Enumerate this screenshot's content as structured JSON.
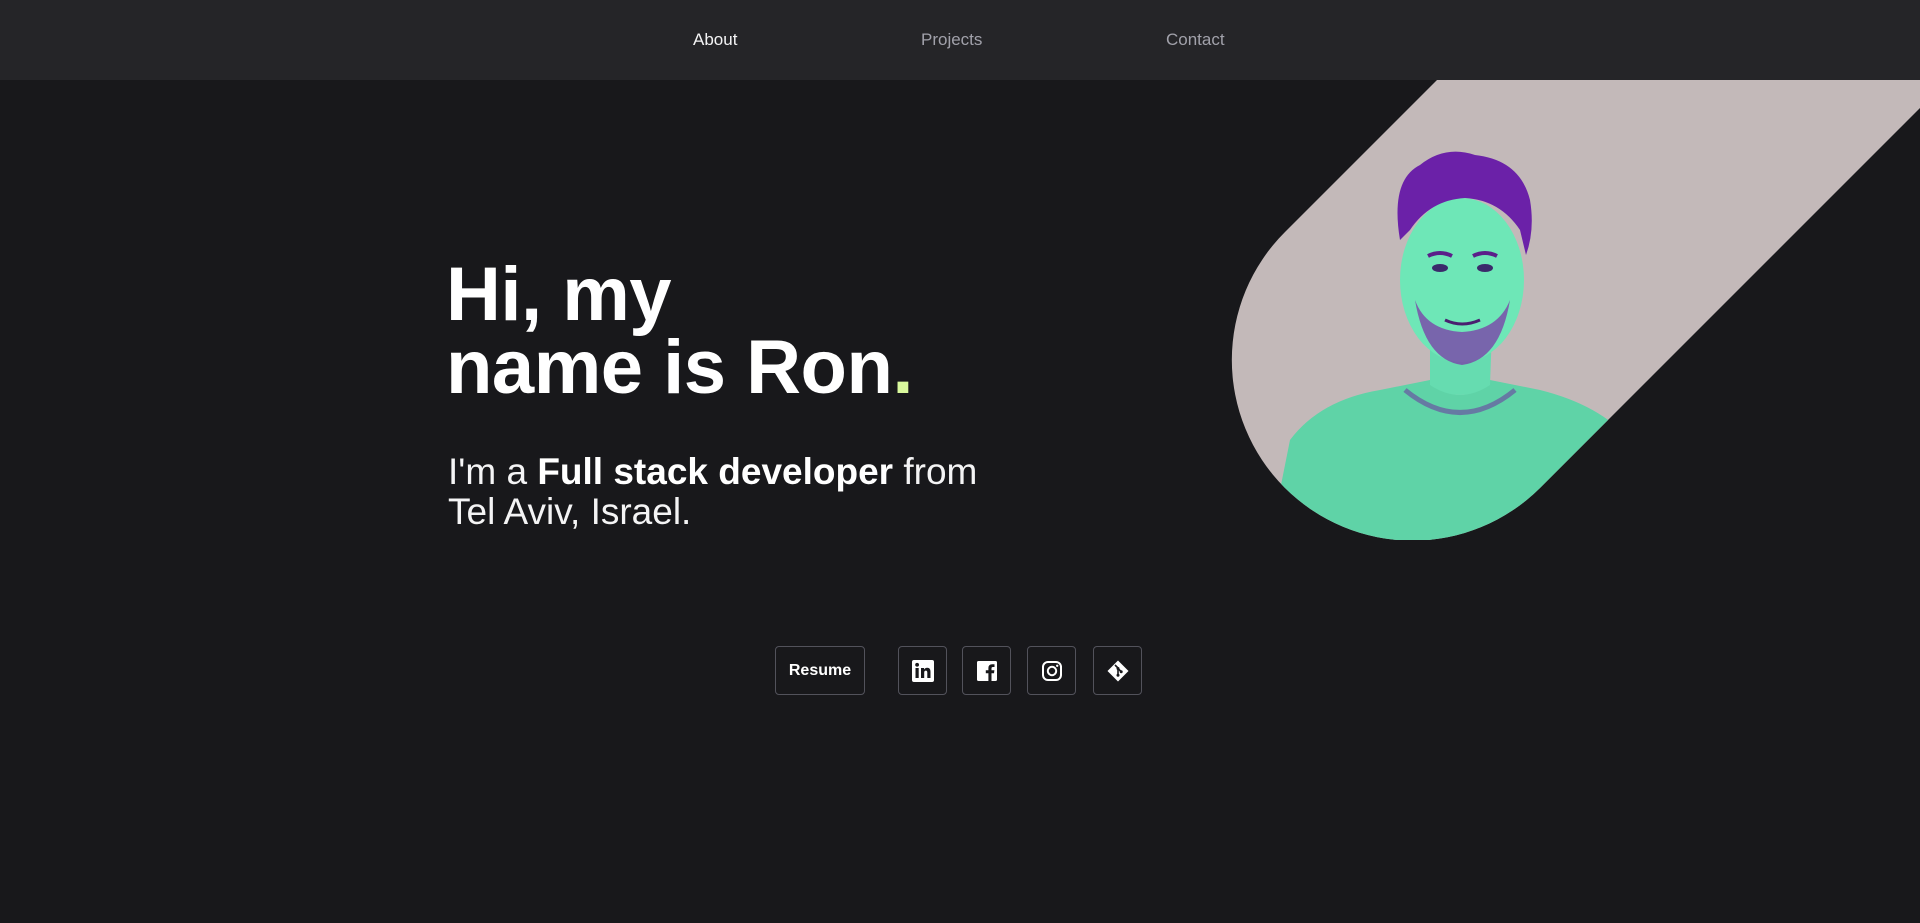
{
  "nav": {
    "items": [
      {
        "label": "About",
        "active": true
      },
      {
        "label": "Projects",
        "active": false
      },
      {
        "label": "Contact",
        "active": false
      }
    ]
  },
  "hero": {
    "title_line1": "Hi, my",
    "title_line2": "name is Ron",
    "title_dot": ".",
    "subtitle_prefix": "I'm a ",
    "subtitle_role": "Full stack developer",
    "subtitle_suffix": " from",
    "subtitle_line2": "Tel Aviv, Israel."
  },
  "actions": {
    "resume_label": "Resume",
    "social": [
      {
        "icon": "linkedin-icon"
      },
      {
        "icon": "facebook-icon"
      },
      {
        "icon": "instagram-icon"
      },
      {
        "icon": "git-icon"
      }
    ]
  },
  "colors": {
    "background": "#18181b",
    "nav_background": "#252528",
    "accent_dot": "#d9f99d",
    "portrait_backdrop": "#c3b9b9",
    "portrait_skin": "#6ee7b7",
    "portrait_hair": "#6b21a8"
  }
}
